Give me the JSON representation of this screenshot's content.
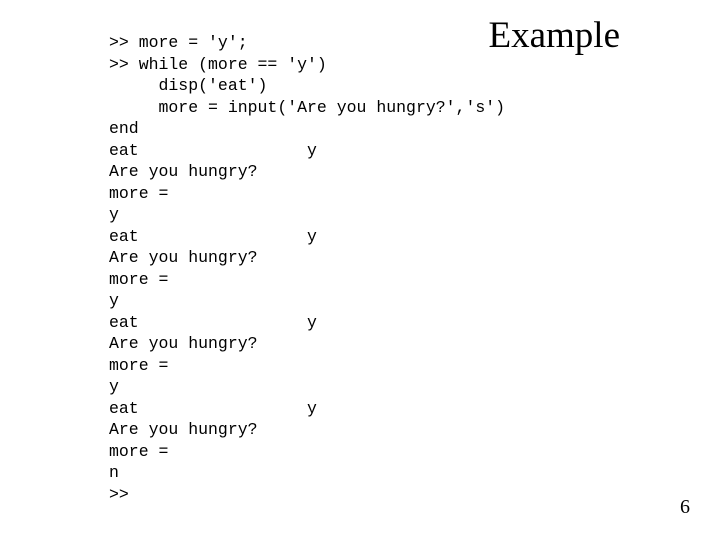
{
  "slide": {
    "title": "Example",
    "page_number": "6",
    "background_color": "#ffffff",
    "text_color": "#000000"
  },
  "console": {
    "lines": [
      ">> more = 'y';",
      ">> while (more == 'y')",
      "     disp('eat')",
      "     more = input('Are you hungry?','s')",
      "end",
      "eat                 y",
      "Are you hungry?",
      "more =",
      "y",
      "eat                 y",
      "Are you hungry?",
      "more =",
      "y",
      "eat                 y",
      "Are you hungry?",
      "more =",
      "y",
      "eat                 y",
      "Are you hungry?",
      "more =",
      "n",
      ">>"
    ]
  }
}
